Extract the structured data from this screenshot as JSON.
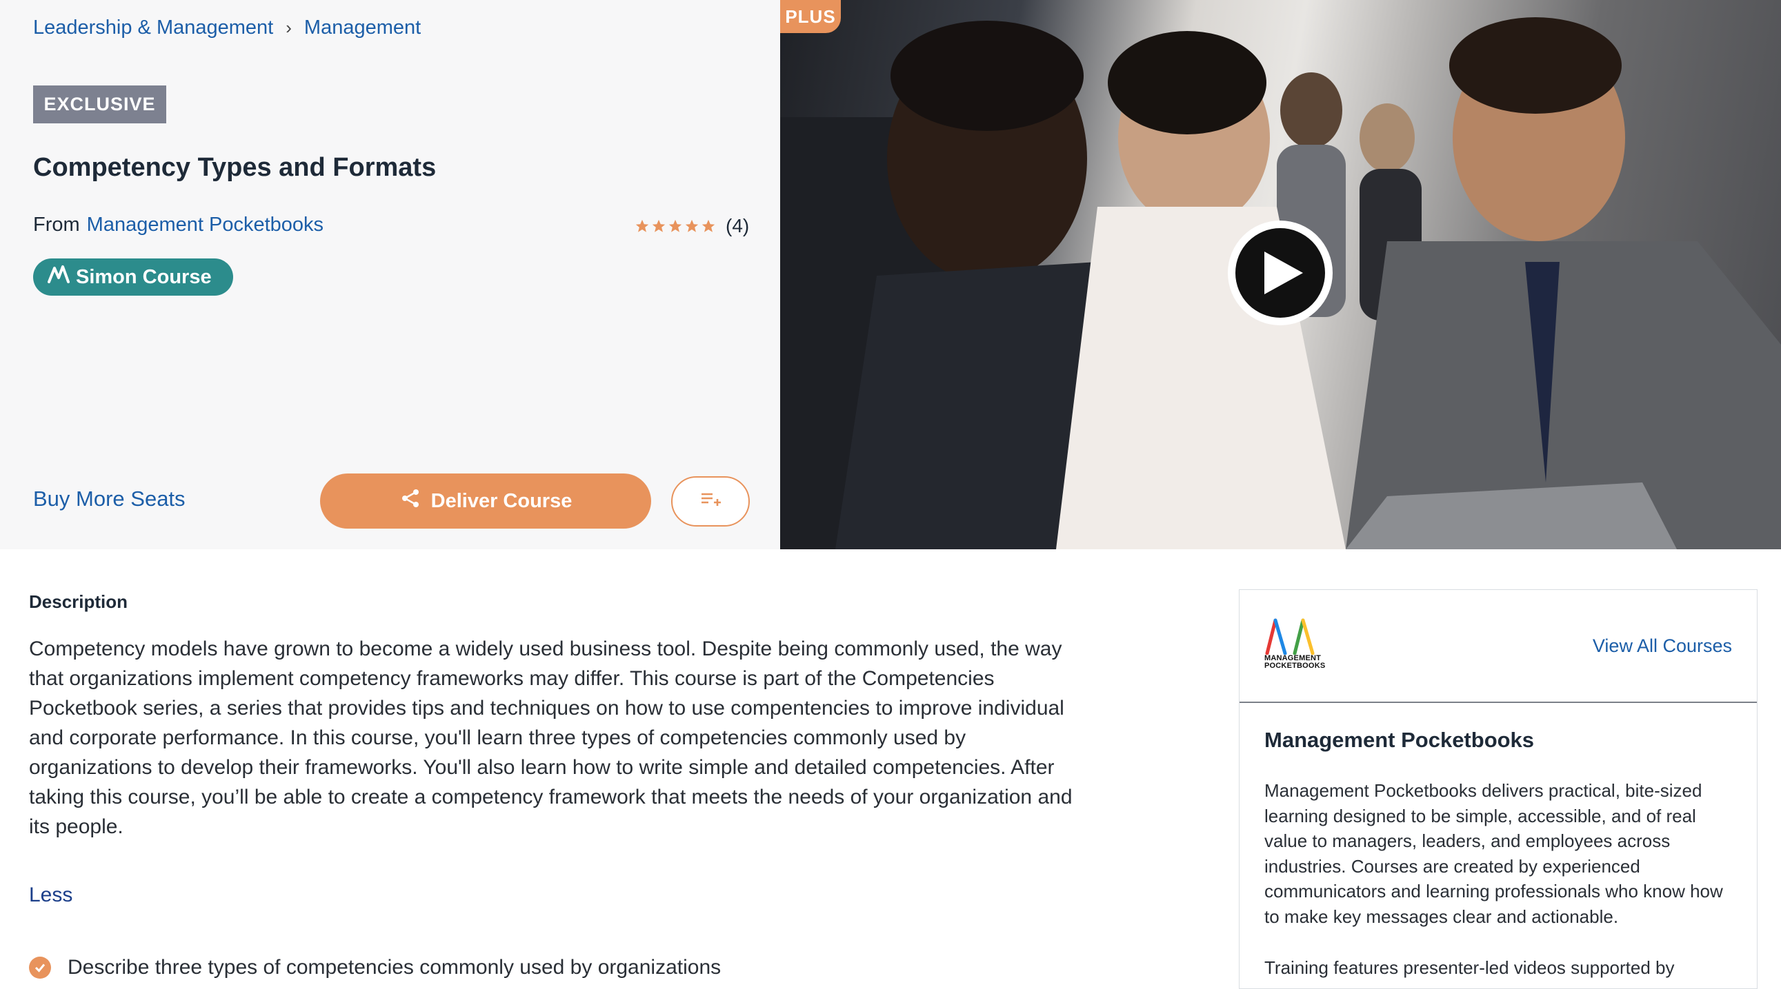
{
  "breadcrumb": {
    "items": [
      "Leadership & Management",
      "Management"
    ],
    "separator": "›"
  },
  "course": {
    "badge": "EXCLUSIVE",
    "title": "Competency Types and Formats",
    "from_label": "From",
    "vendor": "Management Pocketbooks",
    "rating_stars": 5,
    "rating_count": "(4)",
    "type_badge": "Simon Course"
  },
  "actions": {
    "buy_seats": "Buy More Seats",
    "deliver": "Deliver Course",
    "playlist_icon": "playlist-add-icon"
  },
  "video": {
    "tier_badge": "PLUS",
    "play_icon": "play-icon"
  },
  "description": {
    "heading": "Description",
    "text": "Competency models have grown to become a widely used business tool. Despite being commonly used, the way that organizations implement competency frameworks may differ. This course is part of the Competencies Pocketbook series, a series that provides tips and techniques on how to use compentencies to improve individual and corporate performance. In this course, you'll learn three types of competencies commonly used by organizations to develop their frameworks. You'll also learn how to write simple and detailed competencies. After taking this course, you’ll be able to create a competency framework that meets the needs of your organization and its people.",
    "toggle": "Less",
    "objectives": [
      "Describe three types of competencies commonly used by organizations"
    ]
  },
  "vendor_card": {
    "logo_text_line1": "MANAGEMENT",
    "logo_text_line2": "POCKETBOOKS",
    "view_all": "View All Courses",
    "name": "Management Pocketbooks",
    "about": "Management Pocketbooks delivers practical, bite-sized learning designed to be simple, accessible, and of real value to managers, leaders, and employees across industries. Courses are created by experienced communicators and learning professionals who know how to make key messages clear and actionable.",
    "about_more": "Training features presenter-led videos supported by"
  },
  "colors": {
    "accent": "#e8935c",
    "link": "#1c5ea8",
    "teal": "#2c8c8c",
    "badge_gray": "#7d8190"
  }
}
